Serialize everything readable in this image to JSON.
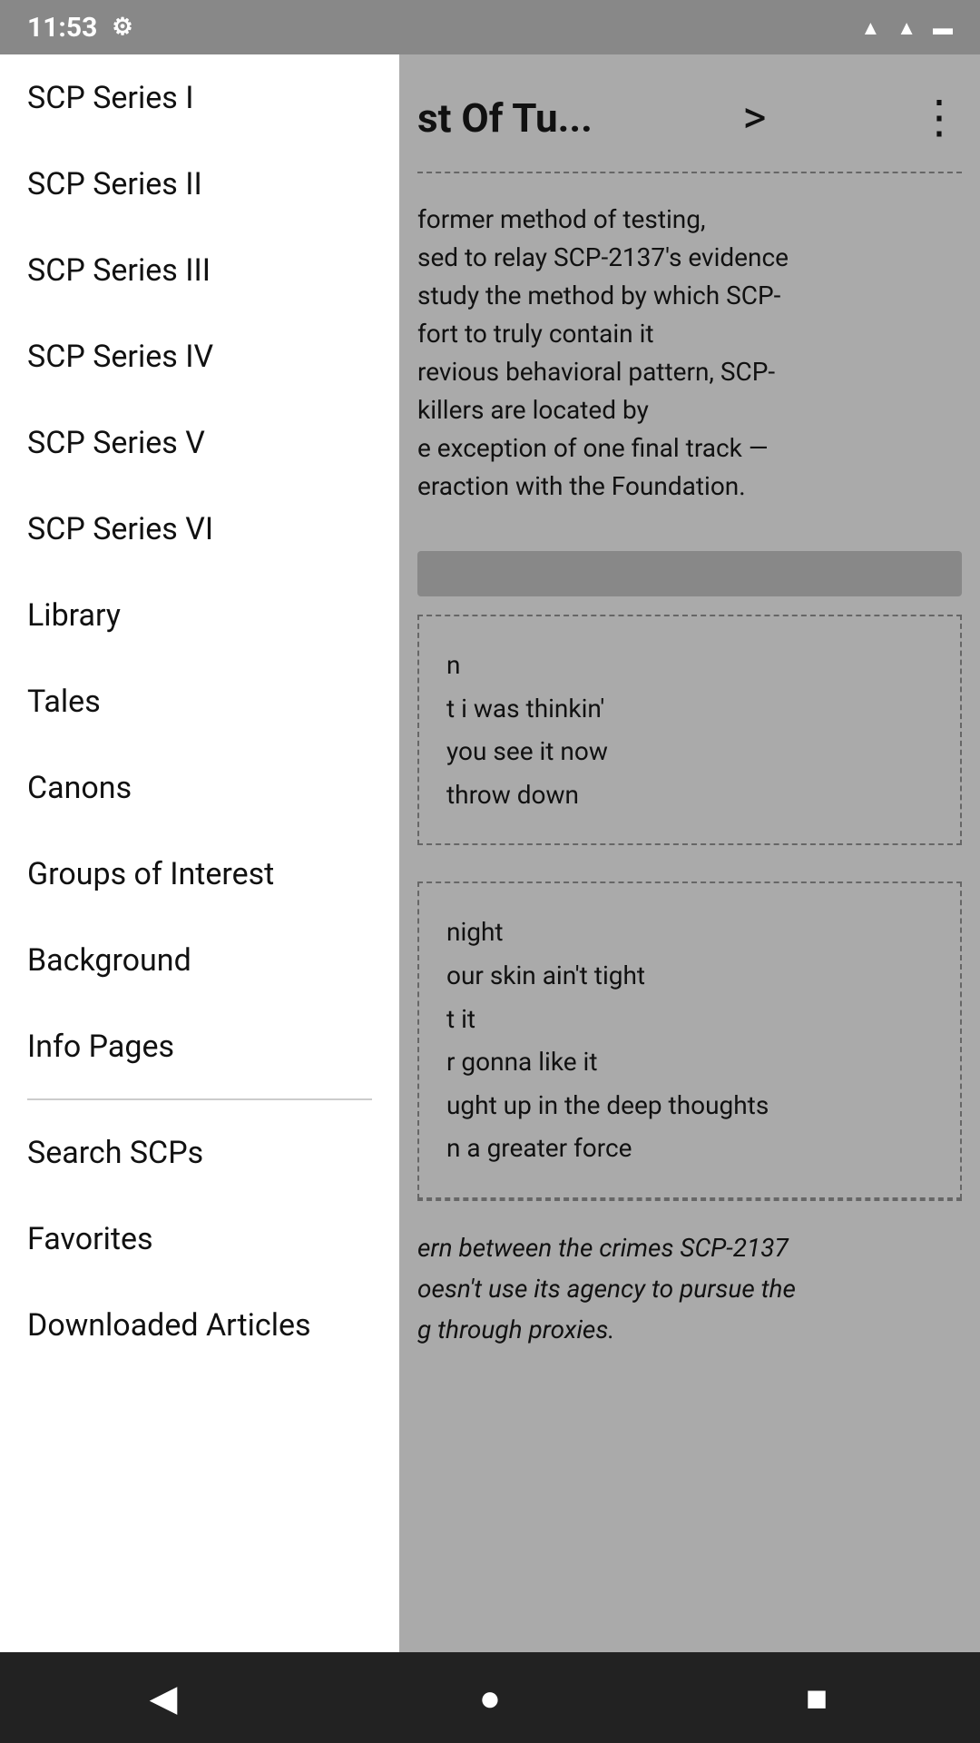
{
  "statusBar": {
    "time": "11:53",
    "icons": [
      "gear",
      "wifi",
      "signal",
      "battery"
    ]
  },
  "header": {
    "title": "st Of Tu...",
    "forwardLabel": ">",
    "menuLabel": "⋮"
  },
  "content": {
    "paragraph1": "former method of testing,\nsed to relay SCP-2137's evidence\nstudy the method by which SCP-\nfort to truly contain it\nrevious behavioral pattern, SCP-\nkillers are located by\ne exception of one final track —\neraction with the Foundation.",
    "paragraph2": "n\nt i was thinkin'\nyou see it now\nthrow down",
    "paragraph3": "night\nour skin ain't tight\nt it\nr gonna like it\nught up in the deep thoughts\nn a greater force",
    "paragraph4": "ern between the crimes SCP-2137\noesn't use its agency to pursue the\ng through proxies."
  },
  "drawer": {
    "items": [
      {
        "id": "scp-series-i",
        "label": "SCP Series I"
      },
      {
        "id": "scp-series-ii",
        "label": "SCP Series II"
      },
      {
        "id": "scp-series-iii",
        "label": "SCP Series III"
      },
      {
        "id": "scp-series-iv",
        "label": "SCP Series IV"
      },
      {
        "id": "scp-series-v",
        "label": "SCP Series V"
      },
      {
        "id": "scp-series-vi",
        "label": "SCP Series VI"
      },
      {
        "id": "library",
        "label": "Library"
      },
      {
        "id": "tales",
        "label": "Tales"
      },
      {
        "id": "canons",
        "label": "Canons"
      },
      {
        "id": "groups-of-interest",
        "label": "Groups of Interest"
      },
      {
        "id": "background",
        "label": "Background"
      },
      {
        "id": "info-pages",
        "label": "Info Pages"
      },
      {
        "id": "search-scps",
        "label": "Search SCPs"
      },
      {
        "id": "favorites",
        "label": "Favorites"
      },
      {
        "id": "downloaded-articles",
        "label": "Downloaded Articles"
      }
    ],
    "dividerAfter": "info-pages"
  },
  "navBar": {
    "back": "◀",
    "home": "●",
    "recents": "■"
  }
}
